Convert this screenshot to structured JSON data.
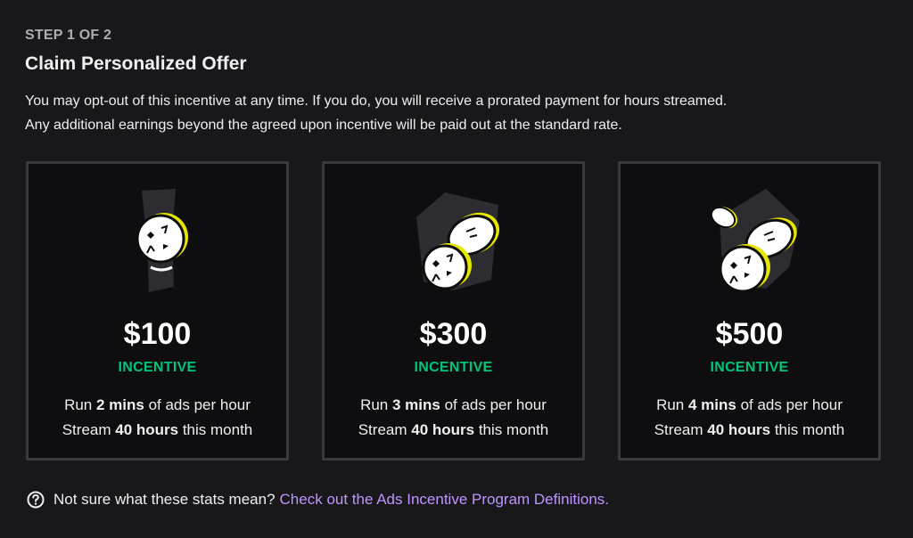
{
  "header": {
    "step": "STEP 1 OF 2",
    "title": "Claim Personalized Offer",
    "description_line1": "You may opt-out of this incentive at any time. If you do, you will receive a prorated payment for hours streamed.",
    "description_line2": "Any additional earnings beyond the agreed upon incentive will be paid out at the standard rate."
  },
  "offers": [
    {
      "amount": "$100",
      "tag": "INCENTIVE",
      "run_prefix": "Run ",
      "run_bold": "2 mins",
      "run_suffix": " of ads per hour",
      "stream_prefix": "Stream ",
      "stream_bold": "40 hours",
      "stream_suffix": " this month",
      "icon": "single-coin-icon"
    },
    {
      "amount": "$300",
      "tag": "INCENTIVE",
      "run_prefix": "Run ",
      "run_bold": "3 mins",
      "run_suffix": " of ads per hour",
      "stream_prefix": "Stream ",
      "stream_bold": "40 hours",
      "stream_suffix": " this month",
      "icon": "two-coins-icon"
    },
    {
      "amount": "$500",
      "tag": "INCENTIVE",
      "run_prefix": "Run ",
      "run_bold": "4 mins",
      "run_suffix": " of ads per hour",
      "stream_prefix": "Stream ",
      "stream_bold": "40 hours",
      "stream_suffix": " this month",
      "icon": "three-coins-icon"
    }
  ],
  "footer": {
    "question": "Not sure what these stats mean?",
    "link": "Check out the Ads Incentive Program Definitions.",
    "icon": "question-circle-icon"
  },
  "colors": {
    "background": "#18181b",
    "card": "#0e0e10",
    "accent_green": "#00c47a",
    "link_purple": "#bf94ff",
    "coin_yellow": "#e6e600"
  }
}
